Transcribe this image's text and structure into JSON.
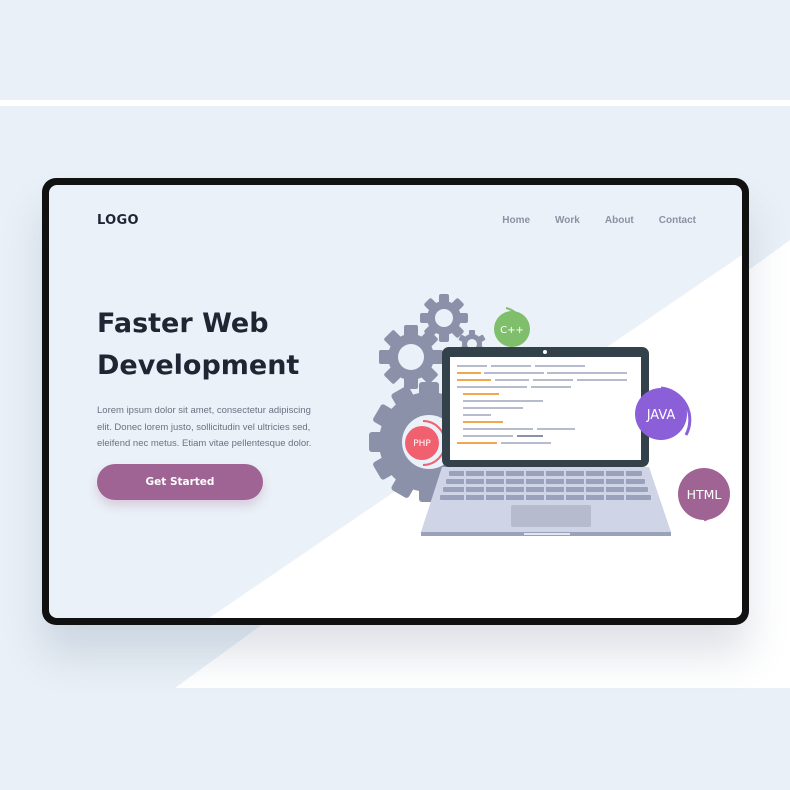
{
  "header": {
    "logo": "LOGO",
    "nav": [
      "Home",
      "Work",
      "About",
      "Contact"
    ]
  },
  "hero": {
    "title_line1": "Faster Web",
    "title_line2": "Development",
    "text_line1": "Lorem ipsum dolor sit amet, consectetur  adipiscing",
    "text_line2": "elit. Donec lorem justo, sollicitudin vel ultricies sed,",
    "text_line3": "eleifend nec metus. Etiam vitae pellentesque dolor.",
    "cta_label": "Get Started"
  },
  "badges": {
    "cpp": "C++",
    "php": "PHP",
    "java": "JAVA",
    "html": "HTML"
  },
  "colors": {
    "background": "#e9f0f7",
    "frame": "#111111",
    "accent": "#a06494",
    "title": "#1e2533",
    "cpp": "#7fbf6b",
    "php": "#f0606e",
    "java": "#8a5fd8",
    "html": "#a06494",
    "gear": "#8a91a9"
  }
}
